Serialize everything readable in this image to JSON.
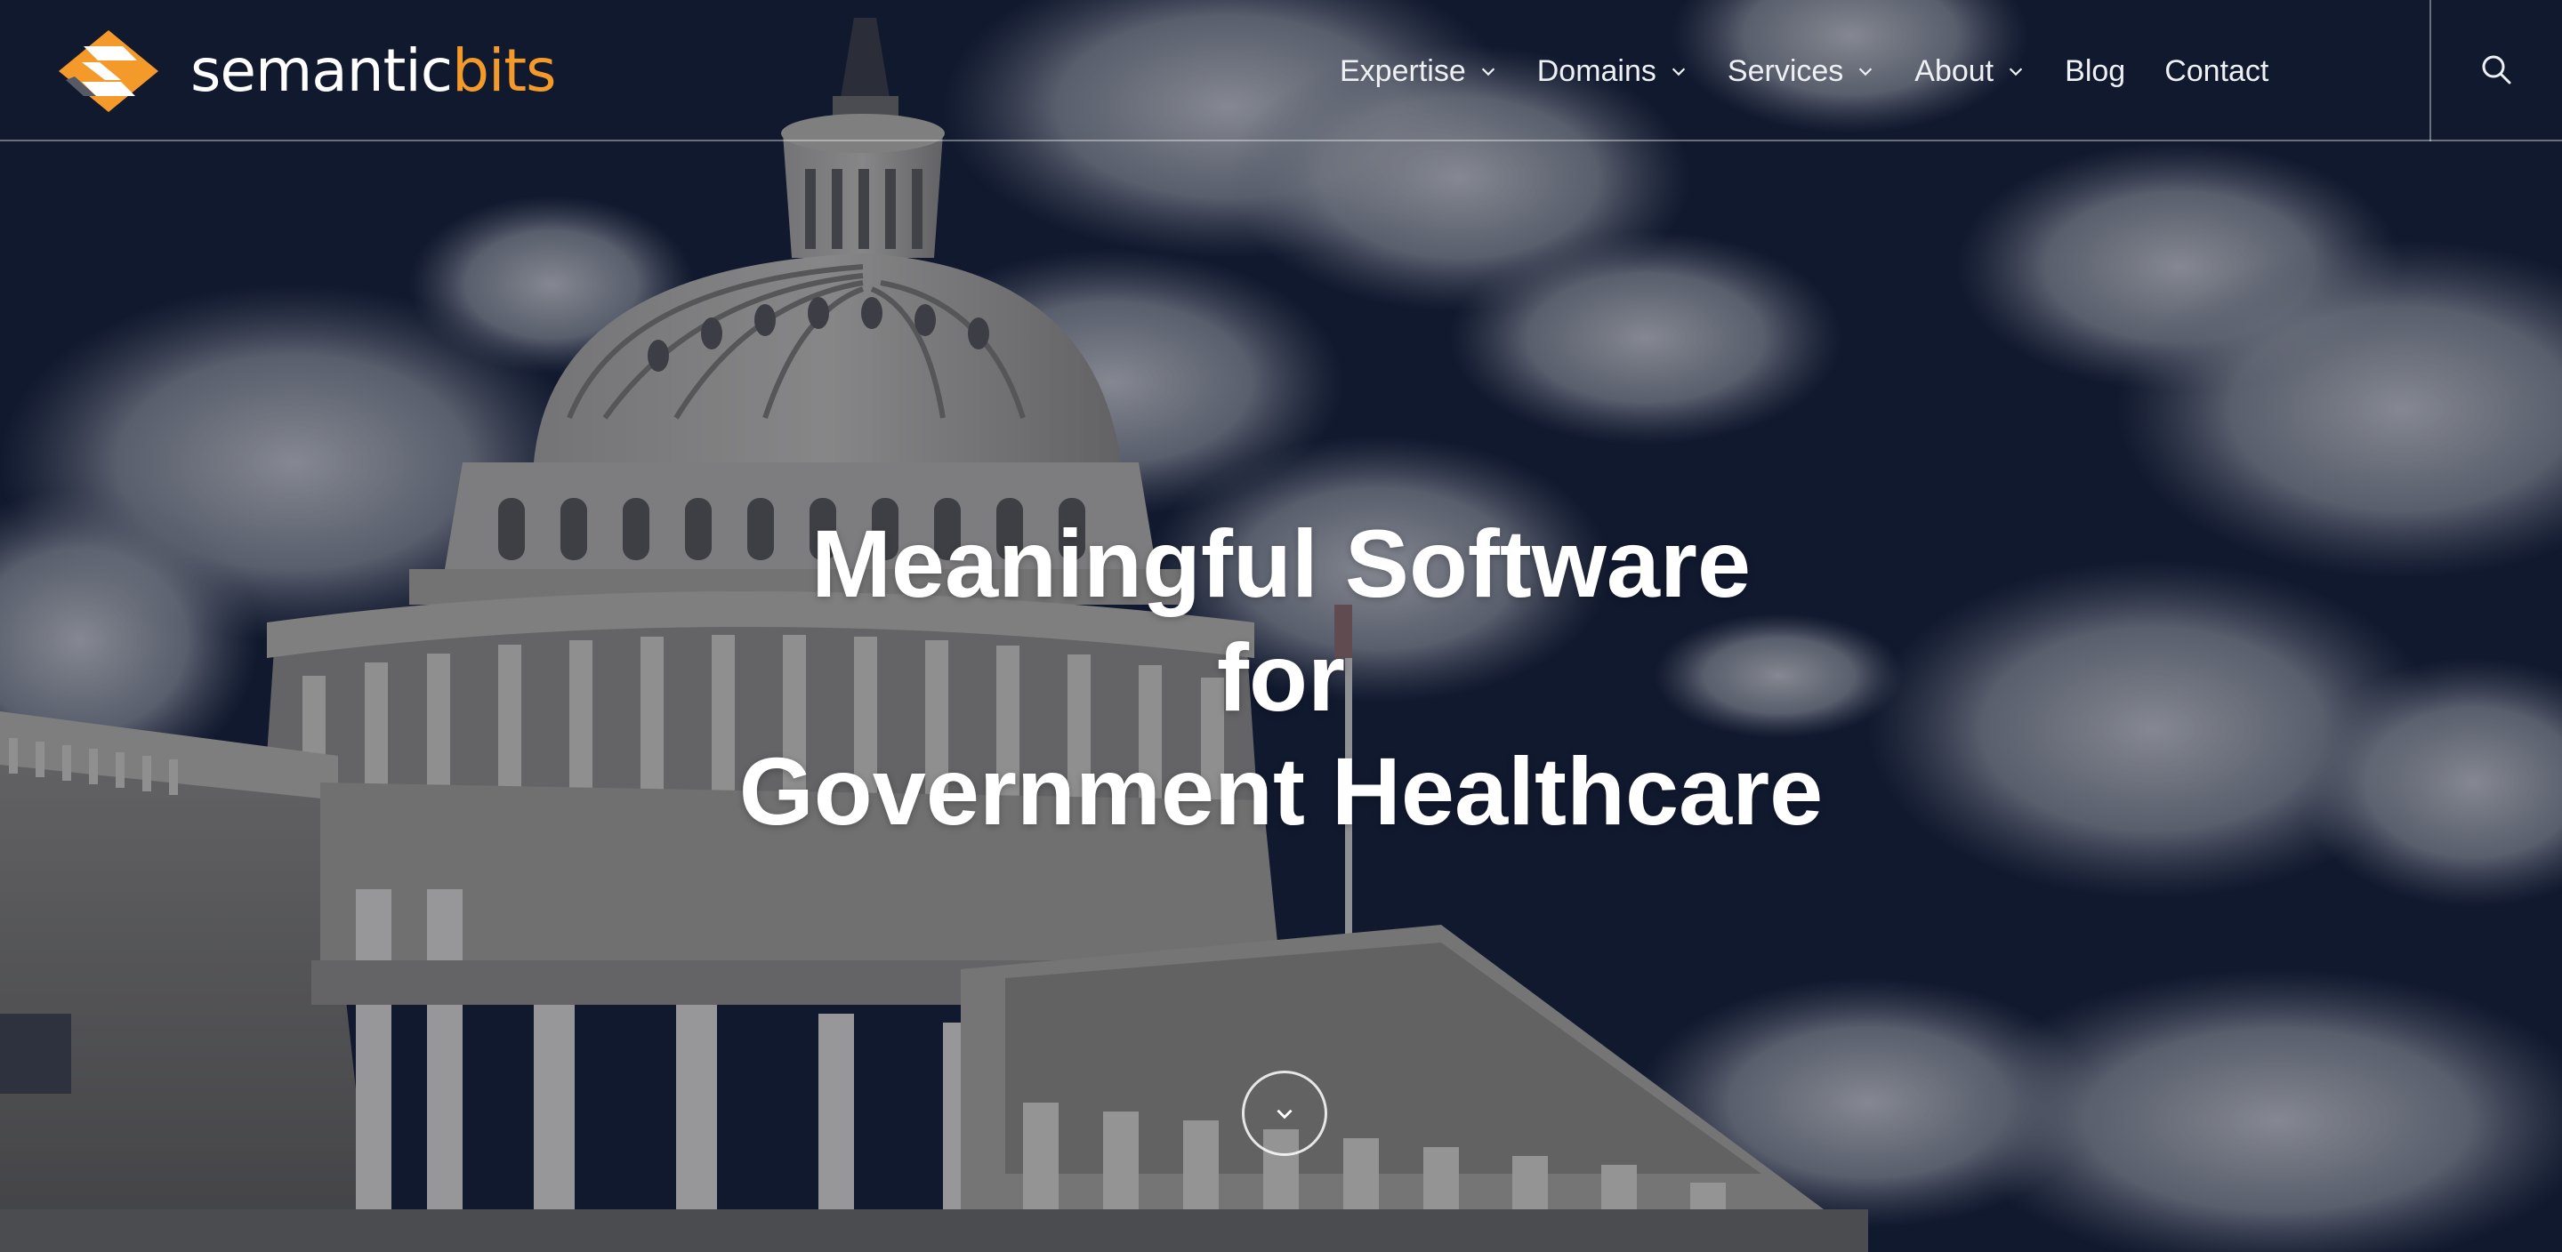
{
  "brand": {
    "name_part1": "semantic",
    "name_part2": "bits",
    "accent_color": "#f39a2b",
    "logo_icon": "semanticbits-logo-icon"
  },
  "nav": {
    "items": [
      {
        "label": "Expertise",
        "has_dropdown": true
      },
      {
        "label": "Domains",
        "has_dropdown": true
      },
      {
        "label": "Services",
        "has_dropdown": true
      },
      {
        "label": "About",
        "has_dropdown": true
      },
      {
        "label": "Blog",
        "has_dropdown": false
      },
      {
        "label": "Contact",
        "has_dropdown": false
      }
    ],
    "search_icon": "search-icon"
  },
  "hero": {
    "headline_line1": "Meaningful Software",
    "headline_line2": "for",
    "headline_line3": "Government Healthcare",
    "background_image": "capitol-building-photo",
    "scroll_icon": "chevron-down-icon"
  }
}
